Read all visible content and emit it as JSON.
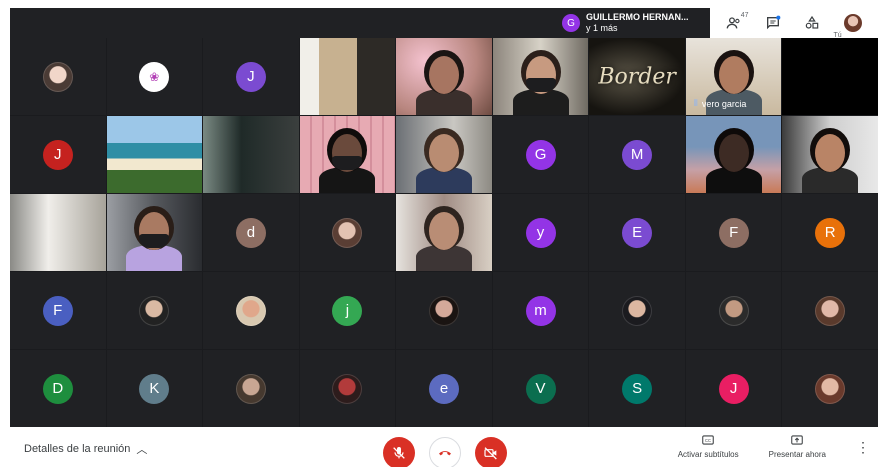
{
  "presenter": {
    "initial": "G",
    "name": "GUILLERMO HERNAN...",
    "more": "y 1 más"
  },
  "top_right": {
    "participants_count": "47",
    "self_label": "Tú"
  },
  "tiles": [
    {
      "kind": "photo",
      "c1": "#f1d6c9",
      "c2": "#4a3b35"
    },
    {
      "kind": "logo"
    },
    {
      "kind": "initial",
      "letter": "J",
      "color": "#7b4bd1"
    },
    {
      "kind": "video",
      "bg": "linear-gradient(90deg,#f1efe9 0 20%,#c7b190 20% 60%,#2d2a26 60% 100%)",
      "person": false
    },
    {
      "kind": "video",
      "bg": "radial-gradient(circle at 30% 30%,#f4c2cf,#b8867f 60%,#6d4b41)",
      "person": true,
      "skin": "#a77561",
      "hair": "#1b1513",
      "shirt": "#3a2f2c"
    },
    {
      "kind": "video",
      "bg": "linear-gradient(90deg,#8c857c,#d7d2c7 50%,#6f6a62)",
      "person": true,
      "skin": "#c79a80",
      "hair": "#2b1f1a",
      "shirt": "#1d1d1d",
      "mask": true
    },
    {
      "kind": "video",
      "bg": "radial-gradient(ellipse at 40% 50%,#5a5446,#161410 70%)",
      "person": false,
      "text": "Border"
    },
    {
      "kind": "video",
      "bg": "linear-gradient(180deg,#e8e3db,#c9b99f)",
      "person": true,
      "skin": "#b07c60",
      "hair": "#1a1210",
      "shirt": "#4d5a63",
      "name": "vero garcia"
    },
    {
      "kind": "black"
    },
    {
      "kind": "initial",
      "letter": "J",
      "color": "#c5221f"
    },
    {
      "kind": "video",
      "bg": "linear-gradient(180deg,#9cc7e8 0 35%,#2f8ea5 35% 55%,#f2e8cf 55% 70%,#3c6b2d 70%)",
      "person": false
    },
    {
      "kind": "video",
      "bg": "linear-gradient(90deg,#7a8a83,#1f2a28 40%,#3b3f3e)",
      "person": false
    },
    {
      "kind": "video",
      "bg": "repeating-linear-gradient(90deg,#e7aab3 0 10px,#d48f9c 10px 12px)",
      "person": true,
      "skin": "#6a4a3c",
      "hair": "#0f0c0b",
      "shirt": "#151515",
      "mask": true
    },
    {
      "kind": "video",
      "bg": "linear-gradient(90deg,#6b6f74,#c9c7c2 60%,#8d8a83)",
      "person": true,
      "skin": "#b98c72",
      "hair": "#3a2a21",
      "shirt": "#2d3b5c"
    },
    {
      "kind": "initial",
      "letter": "G",
      "color": "#9334e6"
    },
    {
      "kind": "initial",
      "letter": "M",
      "color": "#7b4bd1"
    },
    {
      "kind": "video",
      "bg": "linear-gradient(180deg,#7795b9 0 40%,#c6a0a6 70%,#c87a57)",
      "person": true,
      "skin": "#3d2b24",
      "hair": "#0e0a09",
      "shirt": "#0e0e0e"
    },
    {
      "kind": "video",
      "bg": "linear-gradient(90deg,#3b3b3b,#cfcfcf 50%,#e8e8e8)",
      "person": true,
      "skin": "#b98466",
      "hair": "#120d0b",
      "shirt": "#2a2a2a"
    },
    {
      "kind": "video",
      "bg": "linear-gradient(90deg,#8a8a86,#f0eeea 40%,#a7a39a)",
      "person": false
    },
    {
      "kind": "video",
      "bg": "linear-gradient(90deg,#9b9ea3,#56595e 50%,#2a2c30)",
      "person": true,
      "skin": "#a97a62",
      "hair": "#2a1e18",
      "shirt": "#b8a3e0",
      "mask": true
    },
    {
      "kind": "initial",
      "letter": "d",
      "color": "#8d6e63"
    },
    {
      "kind": "photo",
      "c1": "#e3c2b2",
      "c2": "#5a3e34"
    },
    {
      "kind": "video",
      "bg": "linear-gradient(90deg,#e6e3de,#a08c84 50%,#d8cfc4)",
      "person": true,
      "skin": "#b98d75",
      "hair": "#2e241f",
      "shirt": "#3d3535"
    },
    {
      "kind": "initial",
      "letter": "y",
      "color": "#9334e6"
    },
    {
      "kind": "initial",
      "letter": "E",
      "color": "#7b4bd1"
    },
    {
      "kind": "initial",
      "letter": "F",
      "color": "#8d6e63"
    },
    {
      "kind": "initial",
      "letter": "R",
      "color": "#e8710a"
    },
    {
      "kind": "initial",
      "letter": "F",
      "color": "#4a5fc1"
    },
    {
      "kind": "photo",
      "c1": "#d9b9a3",
      "c2": "#222"
    },
    {
      "kind": "photo",
      "c1": "#e0a78b",
      "c2": "#d8c8b0"
    },
    {
      "kind": "initial",
      "letter": "j",
      "color": "#34a853"
    },
    {
      "kind": "photo",
      "c1": "#d4a99a",
      "c2": "#1a1412"
    },
    {
      "kind": "initial",
      "letter": "m",
      "color": "#9334e6"
    },
    {
      "kind": "photo",
      "c1": "#dcb7a1",
      "c2": "#1b1b1f"
    },
    {
      "kind": "photo",
      "c1": "#c29a82",
      "c2": "#2b2b2b"
    },
    {
      "kind": "photo",
      "c1": "#e1b8a8",
      "c2": "#5a3a2c"
    },
    {
      "kind": "initial",
      "letter": "D",
      "color": "#1e8e3e"
    },
    {
      "kind": "initial",
      "letter": "K",
      "color": "#607d8b"
    },
    {
      "kind": "photo",
      "c1": "#c8a693",
      "c2": "#46392f"
    },
    {
      "kind": "photo",
      "c1": "#b23b3b",
      "c2": "#2d1c1c"
    },
    {
      "kind": "initial",
      "letter": "e",
      "color": "#5c6bc0"
    },
    {
      "kind": "initial",
      "letter": "V",
      "color": "#0b6e4f"
    },
    {
      "kind": "initial",
      "letter": "S",
      "color": "#00796b"
    },
    {
      "kind": "initial",
      "letter": "J",
      "color": "#e91e63"
    },
    {
      "kind": "photo",
      "c1": "#e2b9a5",
      "c2": "#6a3a2c"
    }
  ],
  "bottom": {
    "details_label": "Detalles de la reunión",
    "captions_label": "Activar subtítulos",
    "present_label": "Presentar ahora"
  }
}
